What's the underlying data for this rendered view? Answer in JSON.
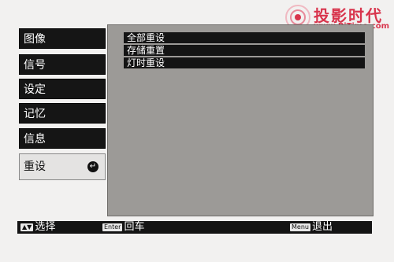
{
  "watermark": {
    "title": "投影时代",
    "url": "www.PjTime.com"
  },
  "menu": {
    "items": [
      {
        "label": "图像"
      },
      {
        "label": "信号"
      },
      {
        "label": "设定"
      },
      {
        "label": "记忆"
      },
      {
        "label": "信息"
      },
      {
        "label": "重设",
        "selected": true
      }
    ],
    "enter_icon": "↵"
  },
  "submenu": {
    "items": [
      {
        "label": "全部重设"
      },
      {
        "label": "存储重置"
      },
      {
        "label": "灯时重设"
      }
    ]
  },
  "hints": {
    "select_key": "▲▼",
    "select_label": "选择",
    "enter_key": "Enter",
    "enter_label": "回车",
    "menu_key": "Menu",
    "menu_label": "退出"
  },
  "colors": {
    "watermark": "#d8344c",
    "menu_background": "#151515",
    "panel_background": "#9c9a97",
    "selected_item": "#e4e3e2"
  }
}
